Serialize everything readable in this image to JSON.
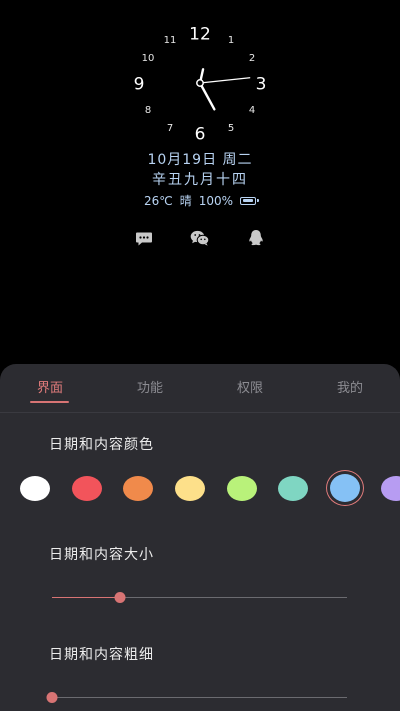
{
  "clock": {
    "numerals": {
      "12": "12",
      "1": "1",
      "2": "2",
      "3": "3",
      "4": "4",
      "5": "5",
      "6": "6",
      "7": "7",
      "8": "8",
      "9": "9",
      "10": "10",
      "11": "11"
    },
    "time": {
      "hour": 12,
      "minute": 25,
      "second": 14
    }
  },
  "date": {
    "gregorian": "10月19日 周二",
    "lunar": "辛丑九月十四",
    "temperature": "26℃",
    "weather": "晴",
    "battery": "100%"
  },
  "notifications": [
    {
      "icon": "message-icon"
    },
    {
      "icon": "wechat-icon"
    },
    {
      "icon": "qq-icon"
    }
  ],
  "settings": {
    "tabs": [
      {
        "label": "界面",
        "active": true
      },
      {
        "label": "功能",
        "active": false
      },
      {
        "label": "权限",
        "active": false
      },
      {
        "label": "我的",
        "active": false
      }
    ],
    "color_label": "日期和内容颜色",
    "colors": [
      "#ffffff",
      "#f2545b",
      "#f08a4b",
      "#fde08a",
      "#b9f27a",
      "#7fd6c2",
      "#85c1f5",
      "#b79cf2"
    ],
    "selected_color_index": 6,
    "size_label": "日期和内容大小",
    "size_value": 0.23,
    "thickness_label": "日期和内容粗细",
    "thickness_value": 0.0,
    "accent": "#d87474"
  }
}
